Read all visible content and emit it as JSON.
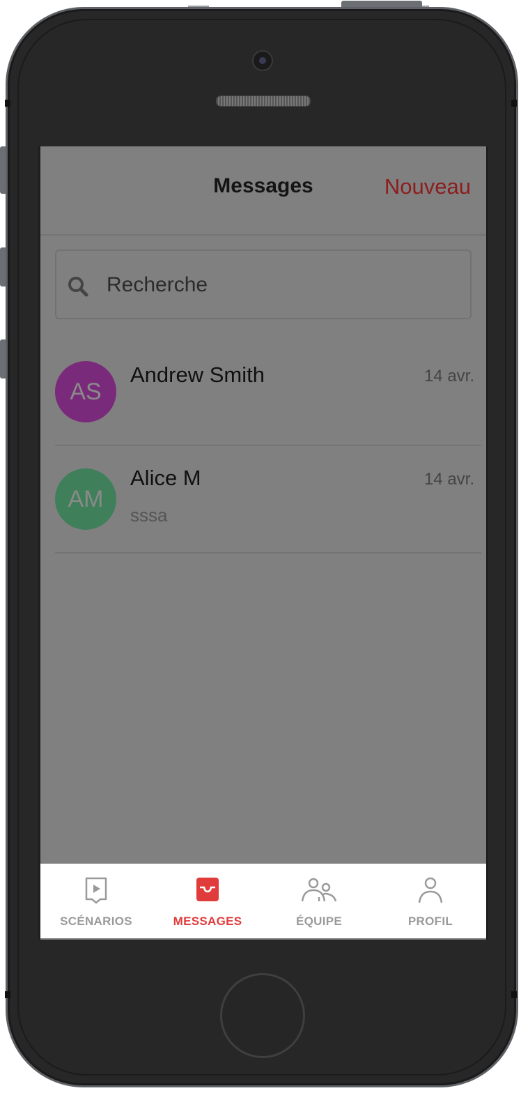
{
  "header": {
    "title": "Messages",
    "action_label": "Nouveau",
    "accent_color": "#8c1d1d"
  },
  "search": {
    "placeholder": "Recherche",
    "value": ""
  },
  "conversations": [
    {
      "initials": "AS",
      "name": "Andrew Smith",
      "date": "14 avr.",
      "preview": "",
      "avatar_color": "#7a2a7a"
    },
    {
      "initials": "AM",
      "name": "Alice M",
      "date": "14 avr.",
      "preview": "sssa",
      "avatar_color": "#3f7f59"
    }
  ],
  "tabbar": {
    "tabs": [
      {
        "label": "SCÉNARIOS",
        "icon": "play-document-icon",
        "active": false
      },
      {
        "label": "MESSAGES",
        "icon": "inbox-icon",
        "active": true
      },
      {
        "label": "ÉQUIPE",
        "icon": "team-icon",
        "active": false
      },
      {
        "label": "PROFIL",
        "icon": "user-icon",
        "active": false
      }
    ],
    "active_color": "#e03c3c",
    "inactive_color": "#9a9a9a"
  }
}
